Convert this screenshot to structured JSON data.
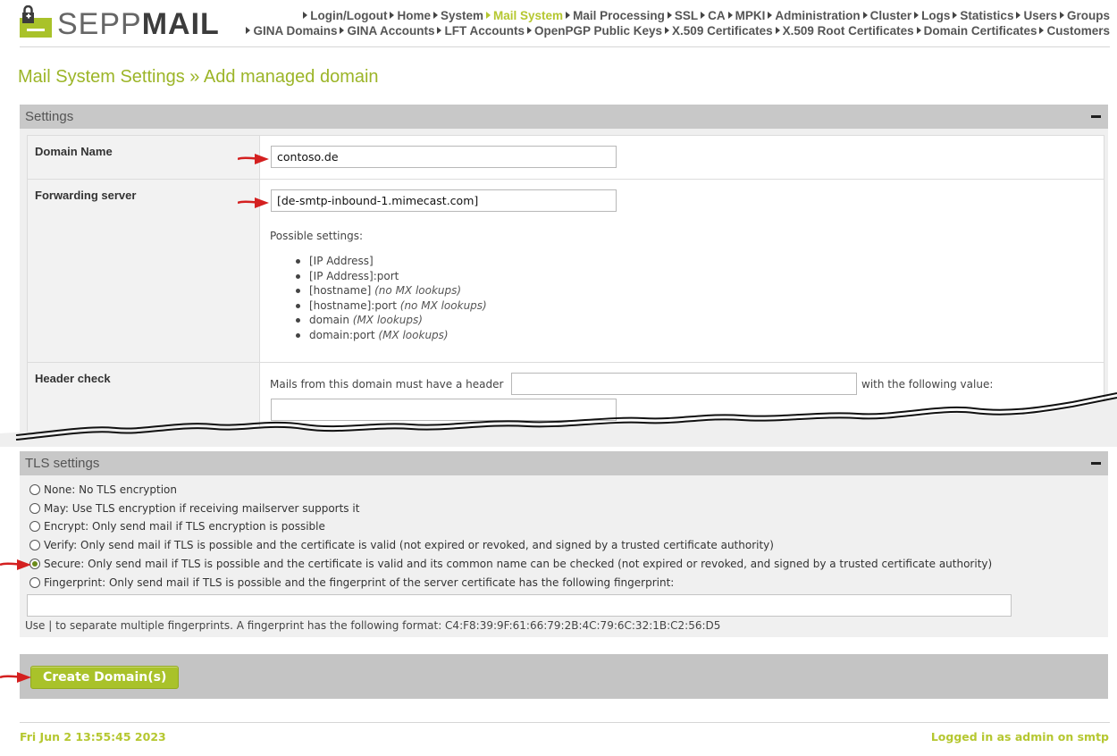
{
  "app": {
    "logo_text_light": "SEPP",
    "logo_text_bold": "MAIL",
    "accent_color": "#b5c730"
  },
  "nav": {
    "row1": [
      {
        "label": "Login/Logout",
        "active": false
      },
      {
        "label": "Home",
        "active": false
      },
      {
        "label": "System",
        "active": false
      },
      {
        "label": "Mail System",
        "active": true
      },
      {
        "label": "Mail Processing",
        "active": false
      },
      {
        "label": "SSL",
        "active": false
      },
      {
        "label": "CA",
        "active": false
      },
      {
        "label": "MPKI",
        "active": false
      },
      {
        "label": "Administration",
        "active": false
      },
      {
        "label": "Cluster",
        "active": false
      },
      {
        "label": "Logs",
        "active": false
      },
      {
        "label": "Statistics",
        "active": false
      },
      {
        "label": "Users",
        "active": false
      },
      {
        "label": "Groups",
        "active": false
      }
    ],
    "row2": [
      {
        "label": "GINA Domains",
        "active": false
      },
      {
        "label": "GINA Accounts",
        "active": false
      },
      {
        "label": "LFT Accounts",
        "active": false
      },
      {
        "label": "OpenPGP Public Keys",
        "active": false
      },
      {
        "label": "X.509 Certificates",
        "active": false
      },
      {
        "label": "X.509 Root Certificates",
        "active": false
      },
      {
        "label": "Domain Certificates",
        "active": false
      },
      {
        "label": "Customers",
        "active": false
      }
    ]
  },
  "page": {
    "title": "Mail System Settings » Add managed domain"
  },
  "settings": {
    "heading": "Settings",
    "domain_name": {
      "label": "Domain Name",
      "value": "contoso.de"
    },
    "forwarding_server": {
      "label": "Forwarding server",
      "value": "[de-smtp-inbound-1.mimecast.com]",
      "hint": "Possible settings:",
      "options": [
        {
          "text": "[IP Address]",
          "note": ""
        },
        {
          "text": "[IP Address]:port",
          "note": ""
        },
        {
          "text": "[hostname] ",
          "note": "(no MX lookups)"
        },
        {
          "text": "[hostname]:port ",
          "note": "(no MX lookups)"
        },
        {
          "text": "domain ",
          "note": "(MX lookups)"
        },
        {
          "text": "domain:port ",
          "note": "(MX lookups)"
        }
      ]
    },
    "header_check": {
      "label": "Header check",
      "text_before": "Mails from this domain must have a header",
      "text_after": "with the following value:",
      "header_value": "",
      "value_value": ""
    }
  },
  "tls": {
    "heading": "TLS settings",
    "options": [
      {
        "label": "None: No TLS encryption",
        "checked": false
      },
      {
        "label": "May: Use TLS encryption if receiving mailserver supports it",
        "checked": false
      },
      {
        "label": "Encrypt: Only send mail if TLS encryption is possible",
        "checked": false
      },
      {
        "label": "Verify: Only send mail if TLS is possible and the certificate is valid (not expired or revoked, and signed by a trusted certificate authority)",
        "checked": false
      },
      {
        "label": "Secure: Only send mail if TLS is possible and the certificate is valid and its common name can be checked (not expired or revoked, and signed by a trusted certificate authority)",
        "checked": true
      },
      {
        "label": "Fingerprint: Only send mail if TLS is possible and the fingerprint of the server certificate has the following fingerprint:",
        "checked": false
      }
    ],
    "fingerprint_value": "",
    "fingerprint_help": "Use | to separate multiple fingerprints. A fingerprint has the following format: C4:F8:39:9F:61:66:79:2B:4C:79:6C:32:1B:C2:56:D5"
  },
  "actions": {
    "create_label": "Create Domain(s)"
  },
  "footer": {
    "datetime": "Fri Jun 2 13:55:45 2023",
    "login_status": "Logged in as admin on smtp"
  },
  "icons": {
    "lock": "lock-icon",
    "collapse": "minus-icon",
    "annotation": "red-arrow-icon"
  }
}
